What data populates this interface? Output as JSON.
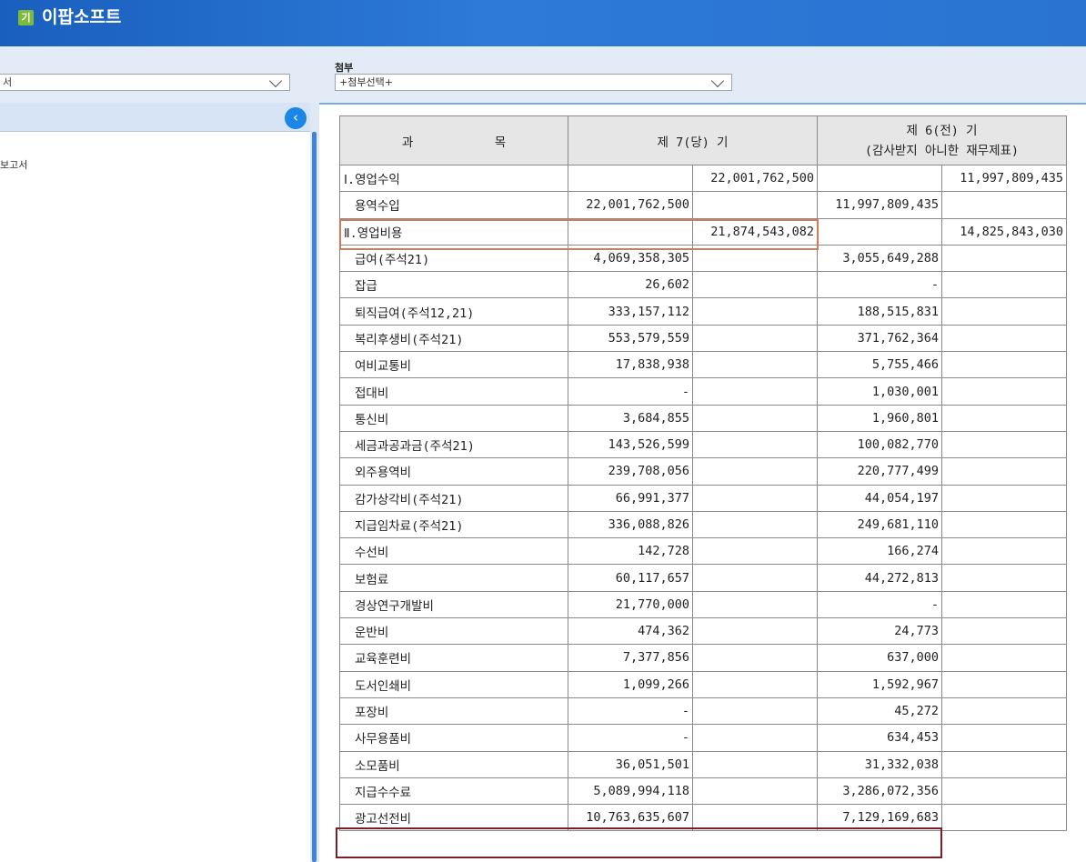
{
  "app": {
    "title": "이팝소프트",
    "logo_text": "기"
  },
  "filters": {
    "left_select_value": "서",
    "attach_label": "첨부",
    "attach_select_value": "+첨부선택+"
  },
  "left_panel": {
    "tree_item": "보고서",
    "collapse_icon": "‹"
  },
  "table": {
    "header": {
      "col1": "과           목",
      "col2": "제 7(당) 기",
      "col3_line1": "제 6(전) 기",
      "col3_line2": "(감사받지 아니한 재무제표)"
    },
    "rows": [
      {
        "name": "Ⅰ.영업수익",
        "sub": false,
        "c1": "",
        "c2": "22,001,762,500",
        "c3": "",
        "c4": "11,997,809,435"
      },
      {
        "name": "용역수입",
        "sub": true,
        "c1": "22,001,762,500",
        "c2": "",
        "c3": "11,997,809,435",
        "c4": ""
      },
      {
        "name": "Ⅱ.영업비용",
        "sub": false,
        "c1": "",
        "c2": "21,874,543,082",
        "c3": "",
        "c4": "14,825,843,030"
      },
      {
        "name": "급여(주석21)",
        "sub": true,
        "c1": "4,069,358,305",
        "c2": "",
        "c3": "3,055,649,288",
        "c4": ""
      },
      {
        "name": "잡급",
        "sub": true,
        "c1": "26,602",
        "c2": "",
        "c3": "-",
        "c4": ""
      },
      {
        "name": "퇴직급여(주석12,21)",
        "sub": true,
        "c1": "333,157,112",
        "c2": "",
        "c3": "188,515,831",
        "c4": ""
      },
      {
        "name": "복리후생비(주석21)",
        "sub": true,
        "c1": "553,579,559",
        "c2": "",
        "c3": "371,762,364",
        "c4": ""
      },
      {
        "name": "여비교통비",
        "sub": true,
        "c1": "17,838,938",
        "c2": "",
        "c3": "5,755,466",
        "c4": ""
      },
      {
        "name": "접대비",
        "sub": true,
        "c1": "-",
        "c2": "",
        "c3": "1,030,001",
        "c4": ""
      },
      {
        "name": "통신비",
        "sub": true,
        "c1": "3,684,855",
        "c2": "",
        "c3": "1,960,801",
        "c4": ""
      },
      {
        "name": "세금과공과금(주석21)",
        "sub": true,
        "c1": "143,526,599",
        "c2": "",
        "c3": "100,082,770",
        "c4": ""
      },
      {
        "name": "외주용역비",
        "sub": true,
        "c1": "239,708,056",
        "c2": "",
        "c3": "220,777,499",
        "c4": ""
      },
      {
        "name": "감가상각비(주석21)",
        "sub": true,
        "c1": "66,991,377",
        "c2": "",
        "c3": "44,054,197",
        "c4": ""
      },
      {
        "name": "지급임차료(주석21)",
        "sub": true,
        "c1": "336,088,826",
        "c2": "",
        "c3": "249,681,110",
        "c4": ""
      },
      {
        "name": "수선비",
        "sub": true,
        "c1": "142,728",
        "c2": "",
        "c3": "166,274",
        "c4": ""
      },
      {
        "name": "보험료",
        "sub": true,
        "c1": "60,117,657",
        "c2": "",
        "c3": "44,272,813",
        "c4": ""
      },
      {
        "name": "경상연구개발비",
        "sub": true,
        "c1": "21,770,000",
        "c2": "",
        "c3": "-",
        "c4": ""
      },
      {
        "name": "운반비",
        "sub": true,
        "c1": "474,362",
        "c2": "",
        "c3": "24,773",
        "c4": ""
      },
      {
        "name": "교육훈련비",
        "sub": true,
        "c1": "7,377,856",
        "c2": "",
        "c3": "637,000",
        "c4": ""
      },
      {
        "name": "도서인쇄비",
        "sub": true,
        "c1": "1,099,266",
        "c2": "",
        "c3": "1,592,967",
        "c4": ""
      },
      {
        "name": "포장비",
        "sub": true,
        "c1": "-",
        "c2": "",
        "c3": "45,272",
        "c4": ""
      },
      {
        "name": "사무용품비",
        "sub": true,
        "c1": "-",
        "c2": "",
        "c3": "634,453",
        "c4": ""
      },
      {
        "name": "소모품비",
        "sub": true,
        "c1": "36,051,501",
        "c2": "",
        "c3": "31,332,038",
        "c4": ""
      },
      {
        "name": "지급수수료",
        "sub": true,
        "c1": "5,089,994,118",
        "c2": "",
        "c3": "3,286,072,356",
        "c4": ""
      },
      {
        "name": "광고선전비",
        "sub": true,
        "c1": "10,763,635,607",
        "c2": "",
        "c3": "7,129,169,683",
        "c4": ""
      }
    ]
  },
  "highlight_colors": {
    "operating_expense_box": "#d07a5e",
    "advertising_box": "#7a1f2a"
  }
}
